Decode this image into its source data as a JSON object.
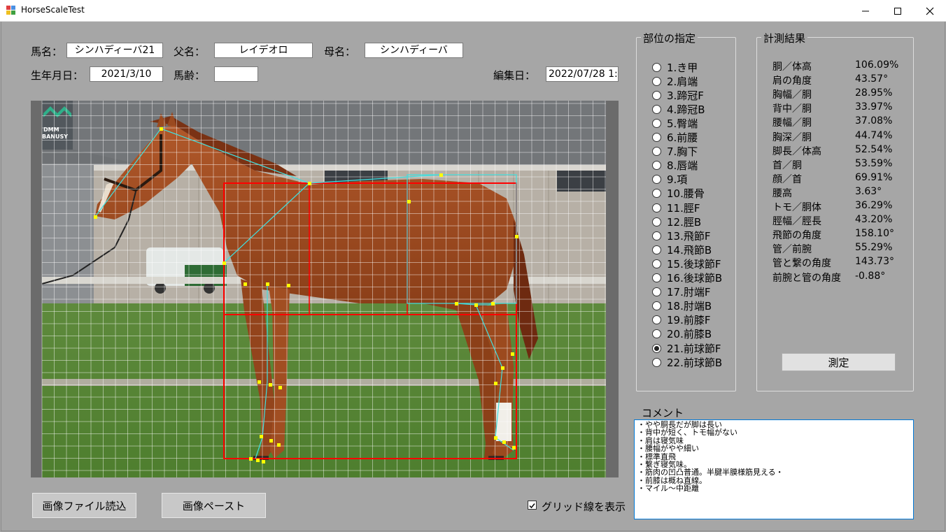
{
  "window": {
    "title": "HorseScaleTest"
  },
  "form": {
    "horse_name_label": "馬名：",
    "horse_name": "シンハディーバ21",
    "sire_label": "父名：",
    "sire": "レイデオロ",
    "dam_label": "母名：",
    "dam": "シンハディーバ",
    "birth_label": "生年月日：",
    "birth": "2021/3/10",
    "age_label": "馬齢：",
    "age": "",
    "edit_date_label": "編集日：",
    "edit_date": "2022/07/28 1:"
  },
  "photo": {
    "logo_text_1": "DMM",
    "logo_text_2": "BANUSY"
  },
  "parts": {
    "title": "部位の指定",
    "selected": "21.前球節F",
    "items": [
      "1.き甲",
      "2.肩端",
      "3.蹄冠F",
      "4.蹄冠B",
      "5.臀端",
      "6.前腰",
      "7.胸下",
      "8.唇端",
      "9.項",
      "10.腰骨",
      "11.脛F",
      "12.脛B",
      "13.飛節F",
      "14.飛節B",
      "15.後球節F",
      "16.後球節B",
      "17.肘端F",
      "18.肘端B",
      "19.前膝F",
      "20.前膝B",
      "21.前球節F",
      "22.前球節B"
    ]
  },
  "results": {
    "title": "計測結果",
    "rows": [
      {
        "name": "胴／体高",
        "value": "106.09%"
      },
      {
        "name": "肩の角度",
        "value": "43.57°"
      },
      {
        "name": "胸幅／胴",
        "value": "28.95%"
      },
      {
        "name": "背中／胴",
        "value": "33.97%"
      },
      {
        "name": "腰幅／胴",
        "value": "37.08%"
      },
      {
        "name": "胸深／胴",
        "value": "44.74%"
      },
      {
        "name": "脚長／体高",
        "value": "52.54%"
      },
      {
        "name": "首／胴",
        "value": "53.59%"
      },
      {
        "name": "顔／首",
        "value": "69.91%"
      },
      {
        "name": "腰高",
        "value": "3.63°"
      },
      {
        "name": "トモ／胴体",
        "value": "36.29%"
      },
      {
        "name": "脛幅／脛長",
        "value": "43.20%"
      },
      {
        "name": "飛節の角度",
        "value": "158.10°"
      },
      {
        "name": "管／前腕",
        "value": "55.29%"
      },
      {
        "name": "管と繋の角度",
        "value": "143.73°"
      },
      {
        "name": "前腕と管の角度",
        "value": "-0.88°"
      }
    ],
    "measure_button": "測定"
  },
  "comment": {
    "label": "コメント",
    "lines": [
      "・やや胴長だが脚は長い",
      "・背中が短く、トモ幅がない",
      "・肩は寝気味",
      "・腰幅がやや細い",
      "・標準直飛",
      "・繋ぎ寝気味。",
      "・筋肉の凹凸普通。半腱半膜様筋見える・",
      "・前膝は概ね直線。",
      "・マイル～中距離"
    ]
  },
  "buttons": {
    "load_image": "画像ファイル読込",
    "paste_image": "画像ペースト"
  },
  "grid_checkbox": {
    "label": "グリッド線を表示",
    "checked": true
  },
  "colors": {
    "form_bg": "#a6a6a6",
    "frame_red": "#ff0000",
    "measure_cyan": "#40e0e0",
    "point_yellow": "#ffff00",
    "focus_blue": "#0078d7"
  }
}
